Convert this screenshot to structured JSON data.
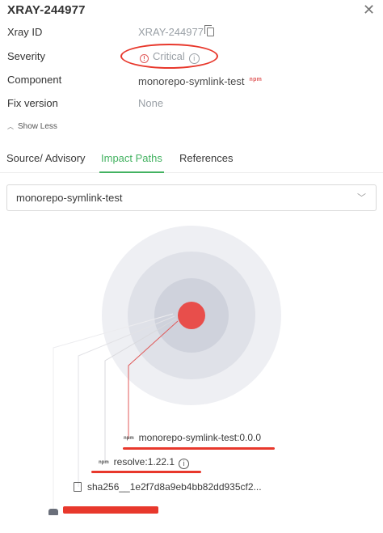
{
  "header": {
    "title": "XRAY-244977",
    "close_label": "✕"
  },
  "details": {
    "xray_id": {
      "label": "Xray ID",
      "value": "XRAY-244977"
    },
    "severity": {
      "label": "Severity",
      "value": "Critical"
    },
    "component": {
      "label": "Component",
      "value": "monorepo-symlink-test",
      "badge": "npm"
    },
    "fix_version": {
      "label": "Fix version",
      "value": "None"
    }
  },
  "show_less": "Show Less",
  "tabs": [
    {
      "label": "Source/ Advisory",
      "active": false
    },
    {
      "label": "Impact Paths",
      "active": true
    },
    {
      "label": "References",
      "active": false
    }
  ],
  "select": {
    "value": "monorepo-symlink-test"
  },
  "impact_graph": {
    "nodes": [
      {
        "label": "monorepo-symlink-test:0.0.0",
        "tag": "npm",
        "icon": "npm-icon"
      },
      {
        "label": "resolve:1.22.1",
        "tag": "npm",
        "icon": "npm-icon",
        "info_icon": true
      },
      {
        "label": "sha256__1e2f7d8a9eb4bb82dd935cf2...",
        "icon": "file-icon"
      },
      {
        "label": "",
        "icon": "docker-icon",
        "redacted": true
      }
    ]
  },
  "colors": {
    "accent_green": "#43b261",
    "critical_red": "#e05a5a",
    "annotation_red": "#e8382c",
    "muted_text": "#9aa0a6"
  },
  "icons": {
    "copy": "copy-icon",
    "severity": "critical-severity-icon",
    "info": "info-icon",
    "chevron_up": "chevron-up-icon",
    "dropdown": "chevron-down-icon",
    "close": "close-icon"
  }
}
